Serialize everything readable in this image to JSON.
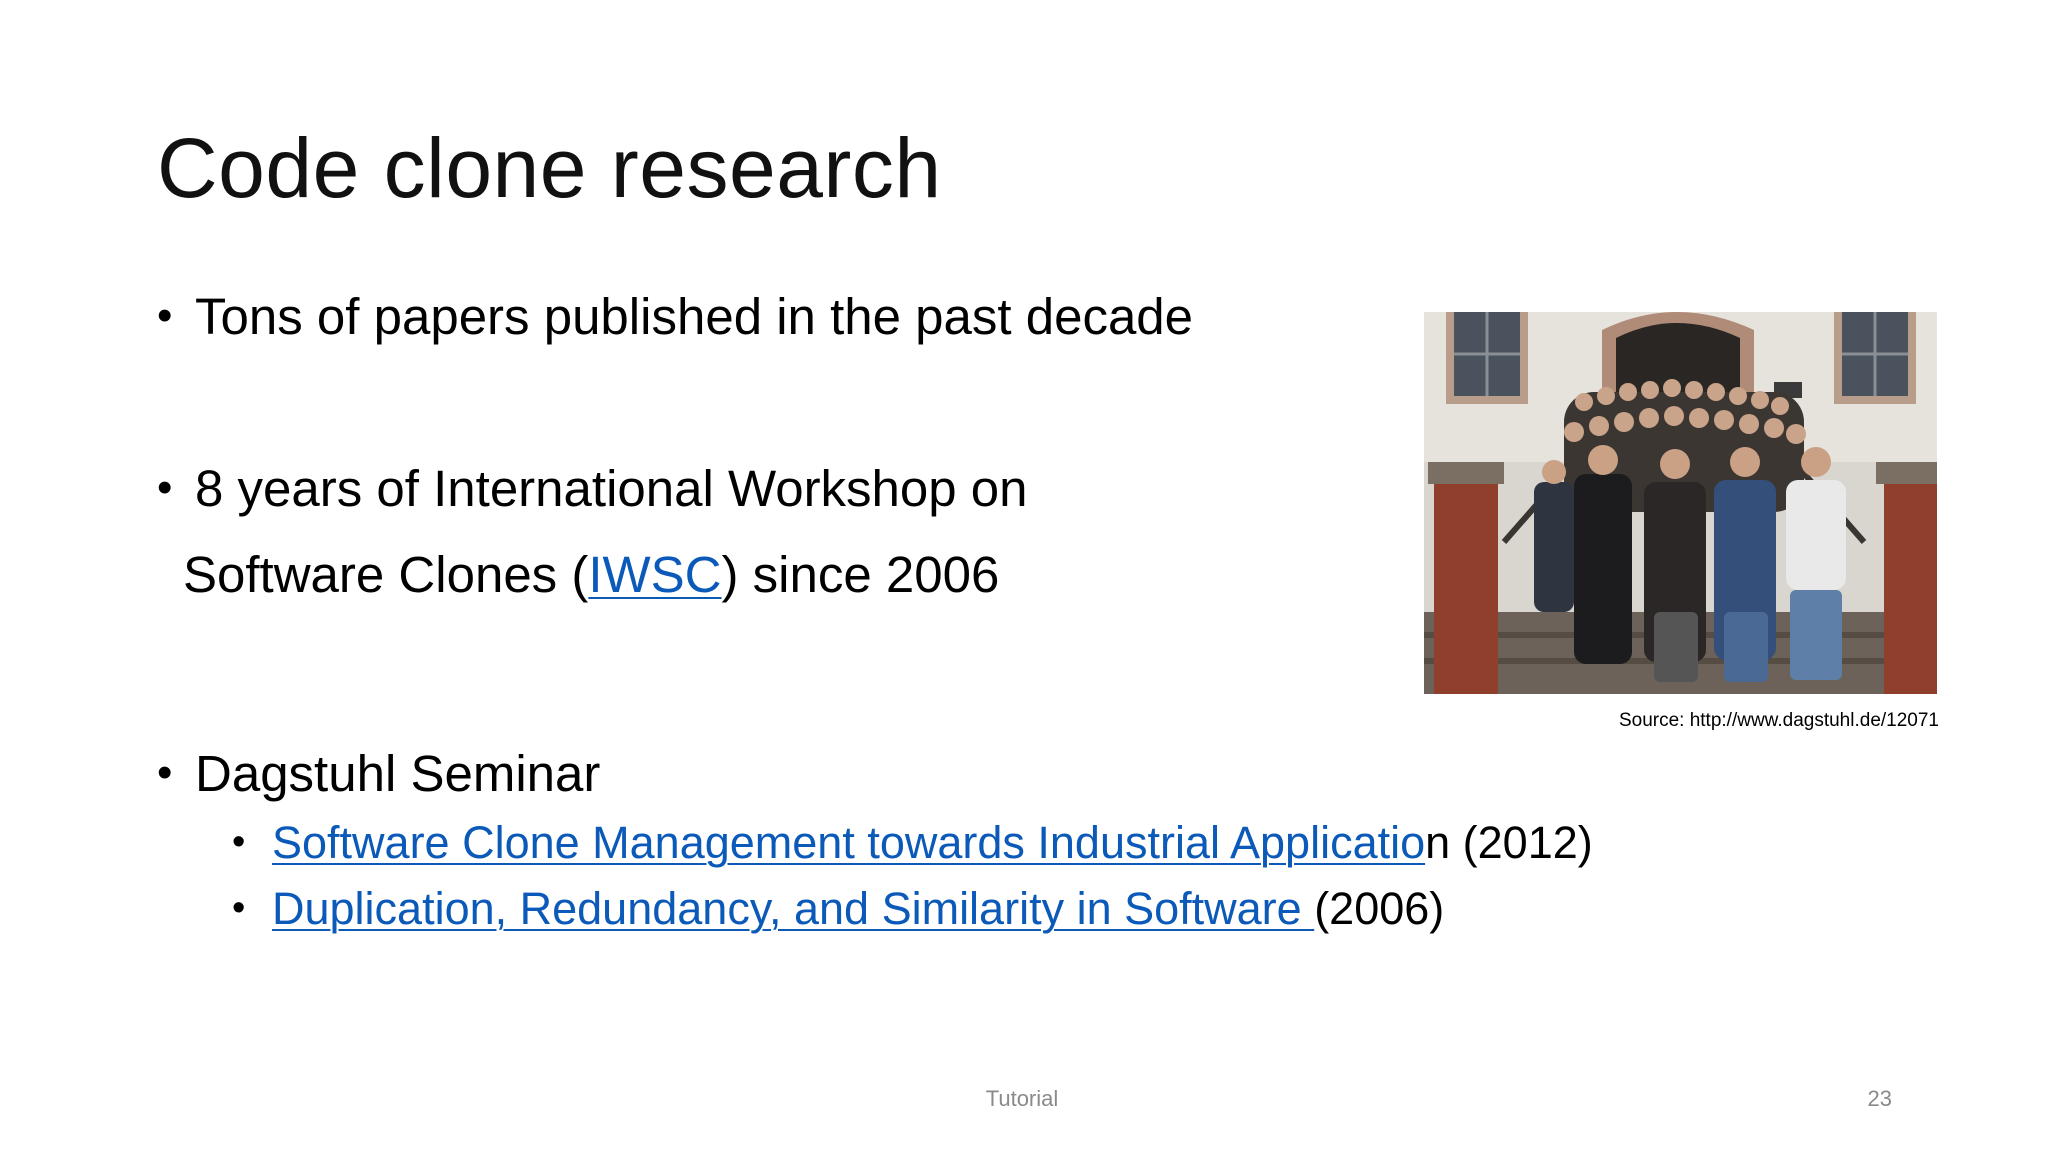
{
  "slide": {
    "title": "Code clone research",
    "bullets": {
      "b1": "Tons of papers published in the past decade",
      "b2_line1": "8 years of International Workshop on",
      "b2_line2_pre": "Software Clones (",
      "b2_link": "IWSC",
      "b2_line2_post": ") since 2006",
      "b3": "Dagstuhl Seminar"
    },
    "sub_bullets": [
      {
        "link": "Software Clone Management towards Industrial Applicatio",
        "suffix": "n (2012)"
      },
      {
        "link": "Duplication, Redundancy, and Similarity in Software ",
        "suffix": "(2006)"
      }
    ],
    "bullet_glyph": "•",
    "image_source": "Source: http://www.dagstuhl.de/12071",
    "footer_label": "Tutorial",
    "page_number": "23",
    "colors": {
      "link": "#0b59b8",
      "text": "#000000",
      "footer": "#8a8a8a"
    }
  }
}
